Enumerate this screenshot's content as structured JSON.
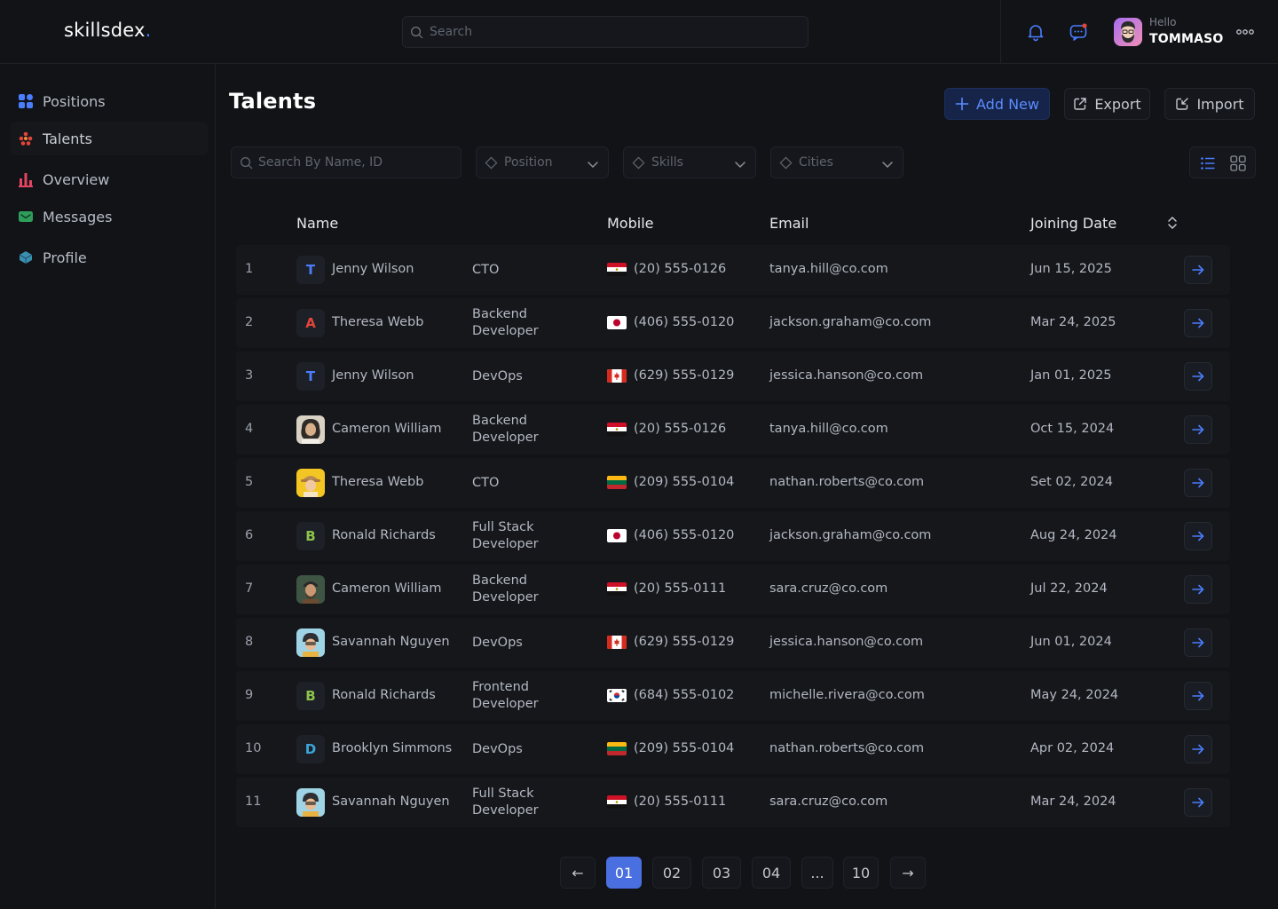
{
  "brand": {
    "name": "skillsdex",
    "dot": "."
  },
  "header": {
    "search_placeholder": "Search",
    "greeting": "Hello",
    "username": "TOMMASO"
  },
  "sidebar": {
    "items": [
      {
        "label": "Positions",
        "icon": "grid-icon"
      },
      {
        "label": "Talents",
        "icon": "people-icon"
      },
      {
        "label": "Overview",
        "icon": "bar-chart-icon"
      },
      {
        "label": "Messages",
        "icon": "mail-icon"
      },
      {
        "label": "Profile",
        "icon": "profile-icon"
      }
    ],
    "active": "Talents"
  },
  "main": {
    "title": "Talents",
    "add_new": "Add New",
    "export": "Export",
    "import": "Import",
    "filters": {
      "search_placeholder": "Search By Name, ID",
      "position": "Position",
      "skills": "Skills",
      "cities": "Cities"
    }
  },
  "table": {
    "columns": {
      "name": "Name",
      "mobile": "Mobile",
      "email": "Email",
      "joining_date": "Joining Date"
    },
    "rows": [
      {
        "num": "1",
        "initial": "T",
        "initial_color": "#4a7dff",
        "avatar": "letter",
        "name": "Jenny Wilson",
        "position": "CTO",
        "flag": "egypt",
        "phone": "(20) 555-0126",
        "email": "tanya.hill@co.com",
        "date": "Jun 15, 2025"
      },
      {
        "num": "2",
        "initial": "A",
        "initial_color": "#e2453a",
        "avatar": "letter",
        "name": "Theresa Webb",
        "position": "Backend Developer",
        "flag": "japan",
        "phone": "(406) 555-0120",
        "email": "jackson.graham@co.com",
        "date": "Mar 24, 2025"
      },
      {
        "num": "3",
        "initial": "T",
        "initial_color": "#4a7dff",
        "avatar": "letter",
        "name": "Jenny Wilson",
        "position": "DevOps",
        "flag": "canada",
        "phone": "(629) 555-0129",
        "email": "jessica.hanson@co.com",
        "date": "Jan 01, 2025"
      },
      {
        "num": "4",
        "initial": "",
        "initial_color": "",
        "avatar": "photo-light",
        "name": "Cameron William",
        "position": "Backend Developer",
        "flag": "egypt",
        "phone": "(20) 555-0126",
        "email": "tanya.hill@co.com",
        "date": "Oct 15, 2024"
      },
      {
        "num": "5",
        "initial": "",
        "initial_color": "",
        "avatar": "photo-yellow",
        "name": "Theresa Webb",
        "position": "CTO",
        "flag": "lithuania",
        "phone": "(209) 555-0104",
        "email": "nathan.roberts@co.com",
        "date": "Set 02, 2024"
      },
      {
        "num": "6",
        "initial": "B",
        "initial_color": "#8bc34a",
        "avatar": "letter",
        "name": "Ronald Richards",
        "position": "Full Stack Developer",
        "flag": "japan",
        "phone": "(406) 555-0120",
        "email": "jackson.graham@co.com",
        "date": "Aug 24, 2024"
      },
      {
        "num": "7",
        "initial": "",
        "initial_color": "",
        "avatar": "photo-green",
        "name": "Cameron William",
        "position": "Backend Developer",
        "flag": "egypt",
        "phone": "(20) 555-0111",
        "email": "sara.cruz@co.com",
        "date": "Jul 22, 2024"
      },
      {
        "num": "8",
        "initial": "",
        "initial_color": "",
        "avatar": "photo-blue",
        "name": "Savannah Nguyen",
        "position": "DevOps",
        "flag": "canada",
        "phone": "(629) 555-0129",
        "email": "jessica.hanson@co.com",
        "date": "Jun 01, 2024"
      },
      {
        "num": "9",
        "initial": "B",
        "initial_color": "#8bc34a",
        "avatar": "letter",
        "name": "Ronald Richards",
        "position": "Frontend Developer",
        "flag": "korea",
        "phone": "(684) 555-0102",
        "email": "michelle.rivera@co.com",
        "date": "May 24, 2024"
      },
      {
        "num": "10",
        "initial": "D",
        "initial_color": "#3aa6d9",
        "avatar": "letter",
        "name": "Brooklyn Simmons",
        "position": "DevOps",
        "flag": "lithuania",
        "phone": "(209) 555-0104",
        "email": "nathan.roberts@co.com",
        "date": "Apr 02, 2024"
      },
      {
        "num": "11",
        "initial": "",
        "initial_color": "",
        "avatar": "photo-blue",
        "name": "Savannah Nguyen",
        "position": "Full Stack Developer",
        "flag": "egypt",
        "phone": "(20) 555-0111",
        "email": "sara.cruz@co.com",
        "date": "Mar 24, 2024"
      }
    ]
  },
  "pagination": {
    "prev": "←",
    "pages": [
      "01",
      "02",
      "03",
      "04",
      "...",
      "10"
    ],
    "active": "01",
    "next": "→"
  },
  "colors": {
    "accent": "#4a7dff",
    "background": "#111317",
    "row": "#15171b"
  }
}
